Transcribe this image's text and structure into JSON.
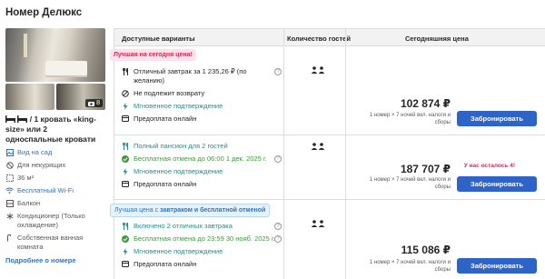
{
  "page": {
    "title": "Номер Делюкс"
  },
  "room": {
    "photo_count": "8",
    "bed_text": "/ 1 кровать «king-size» или 2 односпальные кровати",
    "features": [
      {
        "icon": "view-icon",
        "label": "Вид на сад",
        "link": true
      },
      {
        "icon": "no-smoking-icon",
        "label": "Для некурящих",
        "link": false
      },
      {
        "icon": "area-icon",
        "label": "36 м²",
        "link": false
      },
      {
        "icon": "wifi-icon",
        "label": "Бесплатный Wi-Fi",
        "link": true
      },
      {
        "icon": "balcony-icon",
        "label": "Балкон",
        "link": false
      },
      {
        "icon": "ac-icon",
        "label": "Кондиционер (Только охлаждение)",
        "link": false
      },
      {
        "icon": "bathroom-icon",
        "label": "Собственная ванная комната",
        "link": false
      }
    ],
    "more_link": "Подробнее о номере"
  },
  "table": {
    "headers": {
      "options": "Доступные варианты",
      "guests": "Количество гостей",
      "price": "Сегодняшняя цена"
    },
    "rows": [
      {
        "badge": "Лучшая на сегодня цена!",
        "options": [
          {
            "icon": "meal-icon",
            "text": "Отличный завтрак за 1 235,26 ₽ (по желанию)",
            "style": "normal",
            "help": true
          },
          {
            "icon": "no-refund-icon",
            "text": "Не подлежит возврату",
            "style": "normal",
            "help": false
          },
          {
            "icon": "bolt-icon",
            "text": "Мгновенное подтверждение",
            "style": "teal",
            "help": false
          },
          {
            "icon": "card-icon",
            "text": "Предоплата онлайн",
            "style": "normal",
            "help": false
          }
        ],
        "price": "102 874 ₽",
        "note": "1 номер × 7 ночей вкл. налоги и сборы",
        "rooms_left": "",
        "book": "Забронировать"
      },
      {
        "badge": "",
        "options": [
          {
            "icon": "meal-icon",
            "text": "Полный пансион для 2 гостей",
            "style": "teal",
            "help": false
          },
          {
            "icon": "check-icon",
            "text": "Бесплатная отмена до 06:00 1 дек. 2025 г.",
            "style": "green",
            "help": true
          },
          {
            "icon": "bolt-icon",
            "text": "Мгновенное подтверждение",
            "style": "teal",
            "help": false
          },
          {
            "icon": "card-icon",
            "text": "Предоплата онлайн",
            "style": "normal",
            "help": false
          }
        ],
        "price": "187 707 ₽",
        "note": "1 номер × 7 ночей вкл. налоги и сборы",
        "rooms_left": "У нас осталось 4!",
        "book": "Забронировать"
      },
      {
        "badge_prefix": "Лучшая цена с ",
        "badge_bold": "завтраком и бесплатной отменой",
        "options": [
          {
            "icon": "meal-icon",
            "text": "Включено 2 отличных завтрака",
            "style": "teal",
            "help": true
          },
          {
            "icon": "check-icon",
            "text": "Бесплатная отмена до 23:59 30 нояб. 2025 г.",
            "style": "green",
            "help": true
          },
          {
            "icon": "bolt-icon",
            "text": "Мгновенное подтверждение",
            "style": "teal",
            "help": false
          },
          {
            "icon": "card-icon",
            "text": "Предоплата онлайн",
            "style": "normal",
            "help": false
          }
        ],
        "price": "115 086 ₽",
        "note": "1 номер × 7 ночей вкл. налоги и сборы",
        "rooms_left": "",
        "book": "Забронировать"
      }
    ]
  },
  "colors": {
    "primary": "#2e63c8",
    "link": "#2d73c6",
    "green": "#3d9a3a",
    "teal": "#2b8a8a",
    "alert": "#d6264f"
  }
}
